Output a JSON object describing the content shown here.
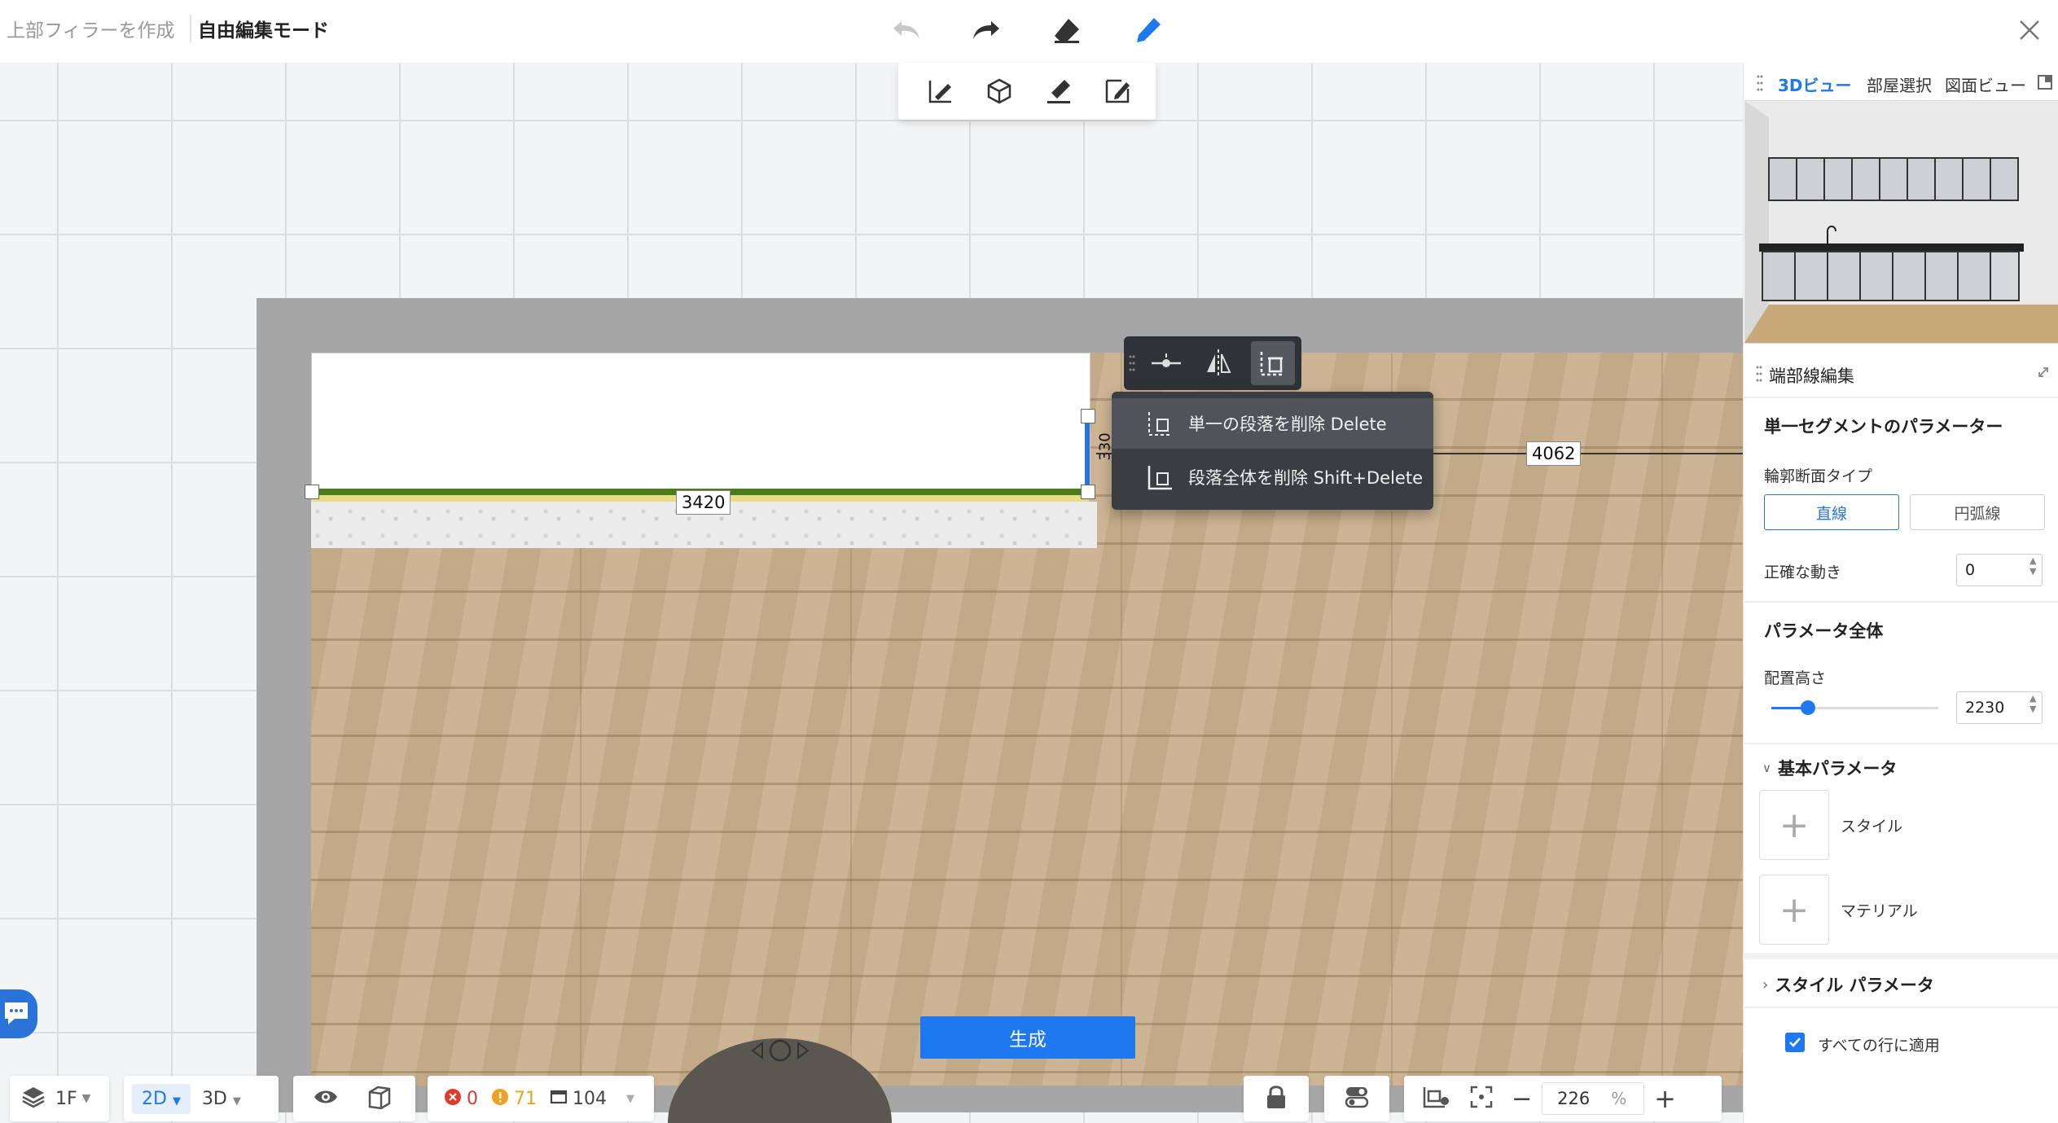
{
  "header": {
    "breadcrumb_parent": "上部フィラーを作成",
    "breadcrumb_current": "自由編集モード",
    "tools": [
      "undo-icon",
      "redo-icon",
      "eraser-icon",
      "pencil-icon"
    ],
    "close_icon": "close-icon"
  },
  "draw_toolbar": {
    "tools": [
      "draw-line-icon",
      "box-icon",
      "brush-icon",
      "edit-shape-icon"
    ]
  },
  "edge_toolbar": {
    "tools": [
      "split-point-icon",
      "mirror-icon",
      "delete-segment-icon"
    ]
  },
  "context_menu": {
    "items": [
      {
        "label": "単一の段落を削除 Delete"
      },
      {
        "label": "段落全体を削除 Shift+Delete"
      }
    ]
  },
  "canvas": {
    "dim_length": "3420",
    "dim_depth": "330",
    "dim_wall": "4062"
  },
  "right_panel": {
    "tabs": [
      {
        "label": "3Dビュー",
        "active": true
      },
      {
        "label": "部屋選択",
        "active": false
      },
      {
        "label": "図面ビュー",
        "active": false
      }
    ],
    "edit_title": "端部線編集",
    "segment_params_title": "単一セグメントのパラメーター",
    "profile_type_label": "輪郭断面タイプ",
    "profile_options": {
      "straight": "直線",
      "arc": "円弧線"
    },
    "precise_move_label": "正確な動き",
    "precise_move_value": "0",
    "global_params_title": "パラメータ全体",
    "install_height_label": "配置高さ",
    "install_height_value": "2230",
    "install_height_slider_fraction": 0.22,
    "basic_params_title": "基本パラメータ",
    "style_label": "スタイル",
    "material_label": "マテリアル",
    "style_params_title": "スタイル パラメータ",
    "apply_all_label": "すべての行に適用",
    "apply_all_checked": true
  },
  "generate_button": "生成",
  "bottom_bar": {
    "floor": "1F",
    "view_2d": "2D",
    "view_3d": "3D",
    "errors": "0",
    "warnings": "71",
    "items": "104",
    "zoom": "226",
    "zoom_unit": "%"
  },
  "colors": {
    "accent": "#1e78f0",
    "error": "#e03a2c",
    "warning": "#f0a020"
  }
}
